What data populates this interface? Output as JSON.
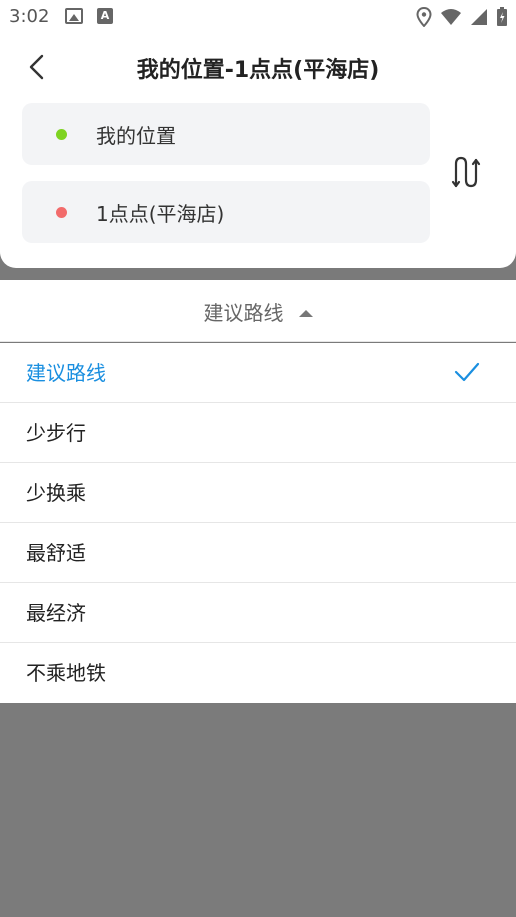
{
  "status_bar": {
    "time": "3:02"
  },
  "header": {
    "title": "我的位置-1点点(平海店)",
    "from": {
      "label": "我的位置",
      "dot_color": "#7ed321"
    },
    "to": {
      "label": "1点点(平海店)",
      "dot_color": "#f26b6b"
    }
  },
  "dropdown": {
    "label": "建议路线",
    "options": [
      {
        "label": "建议路线",
        "selected": true
      },
      {
        "label": "少步行",
        "selected": false
      },
      {
        "label": "少换乘",
        "selected": false
      },
      {
        "label": "最舒适",
        "selected": false
      },
      {
        "label": "最经济",
        "selected": false
      },
      {
        "label": "不乘地铁",
        "selected": false
      }
    ]
  },
  "colors": {
    "accent": "#1a8fe0",
    "overlay": "#7b7b7b"
  }
}
